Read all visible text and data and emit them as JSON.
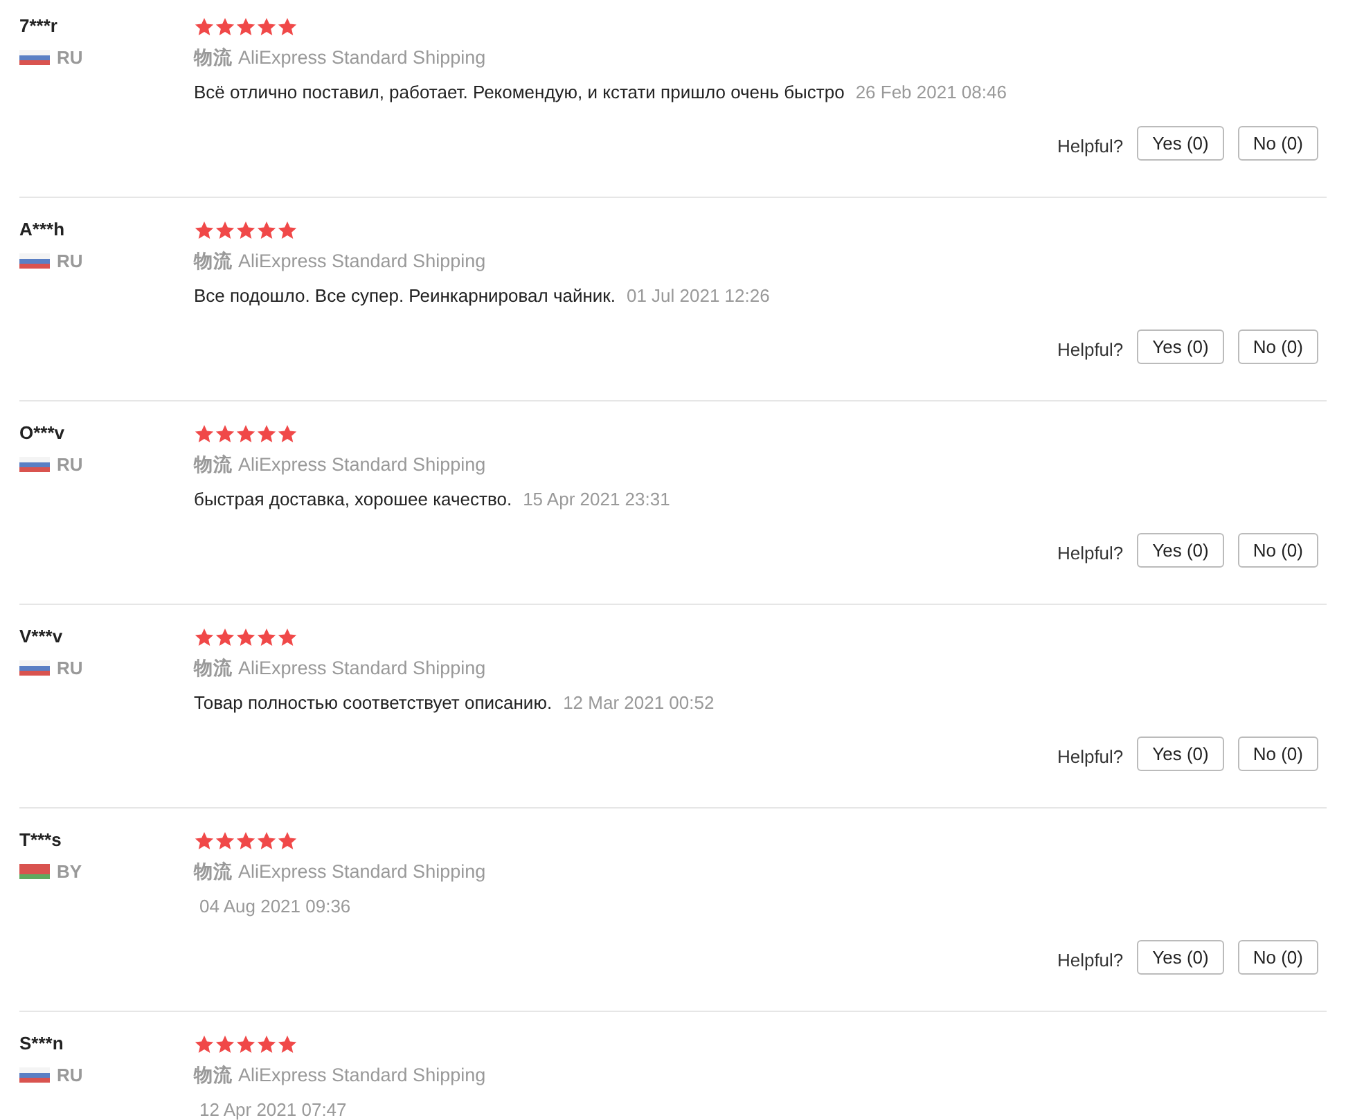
{
  "reviews": [
    {
      "name": "7***r",
      "kind": "ru",
      "country": "RU",
      "stars": 5,
      "shipping_label": "物流",
      "shipping_method": "AliExpress Standard Shipping",
      "comment": "Всё отлично поставил, работает. Рекомендую, и кстати пришло очень быстро",
      "date": "26 Feb 2021 08:46",
      "helpful": {
        "label": "Helpful?",
        "yes": "Yes (0)",
        "no": "No (0)"
      }
    },
    {
      "name": "A***h",
      "kind": "ru",
      "country": "RU",
      "stars": 5,
      "shipping_label": "物流",
      "shipping_method": "AliExpress Standard Shipping",
      "comment": "Все подошло. Все супер. Реинкарнировал чайник.",
      "date": "01 Jul 2021 12:26",
      "helpful": {
        "label": "Helpful?",
        "yes": "Yes (0)",
        "no": "No (0)"
      }
    },
    {
      "name": "O***v",
      "kind": "ru",
      "country": "RU",
      "stars": 5,
      "shipping_label": "物流",
      "shipping_method": "AliExpress Standard Shipping",
      "comment": "быстрая доставка, хорошее качество.",
      "date": "15 Apr 2021 23:31",
      "helpful": {
        "label": "Helpful?",
        "yes": "Yes (0)",
        "no": "No (0)"
      }
    },
    {
      "name": "V***v",
      "kind": "ru",
      "country": "RU",
      "stars": 5,
      "shipping_label": "物流",
      "shipping_method": "AliExpress Standard Shipping",
      "comment": "Товар полностью соответствует описанию.",
      "date": "12 Mar 2021 00:52",
      "helpful": {
        "label": "Helpful?",
        "yes": "Yes (0)",
        "no": "No (0)"
      }
    },
    {
      "name": "T***s",
      "kind": "by",
      "country": "BY",
      "stars": 5,
      "shipping_label": "物流",
      "shipping_method": "AliExpress Standard Shipping",
      "date": "04 Aug 2021 09:36",
      "helpful": {
        "label": "Helpful?",
        "yes": "Yes (0)",
        "no": "No (0)"
      }
    },
    {
      "name": "S***n",
      "kind": "ru",
      "country": "RU",
      "stars": 5,
      "shipping_label": "物流",
      "shipping_method": "AliExpress Standard Shipping",
      "date": "12 Apr 2021 07:47"
    }
  ]
}
